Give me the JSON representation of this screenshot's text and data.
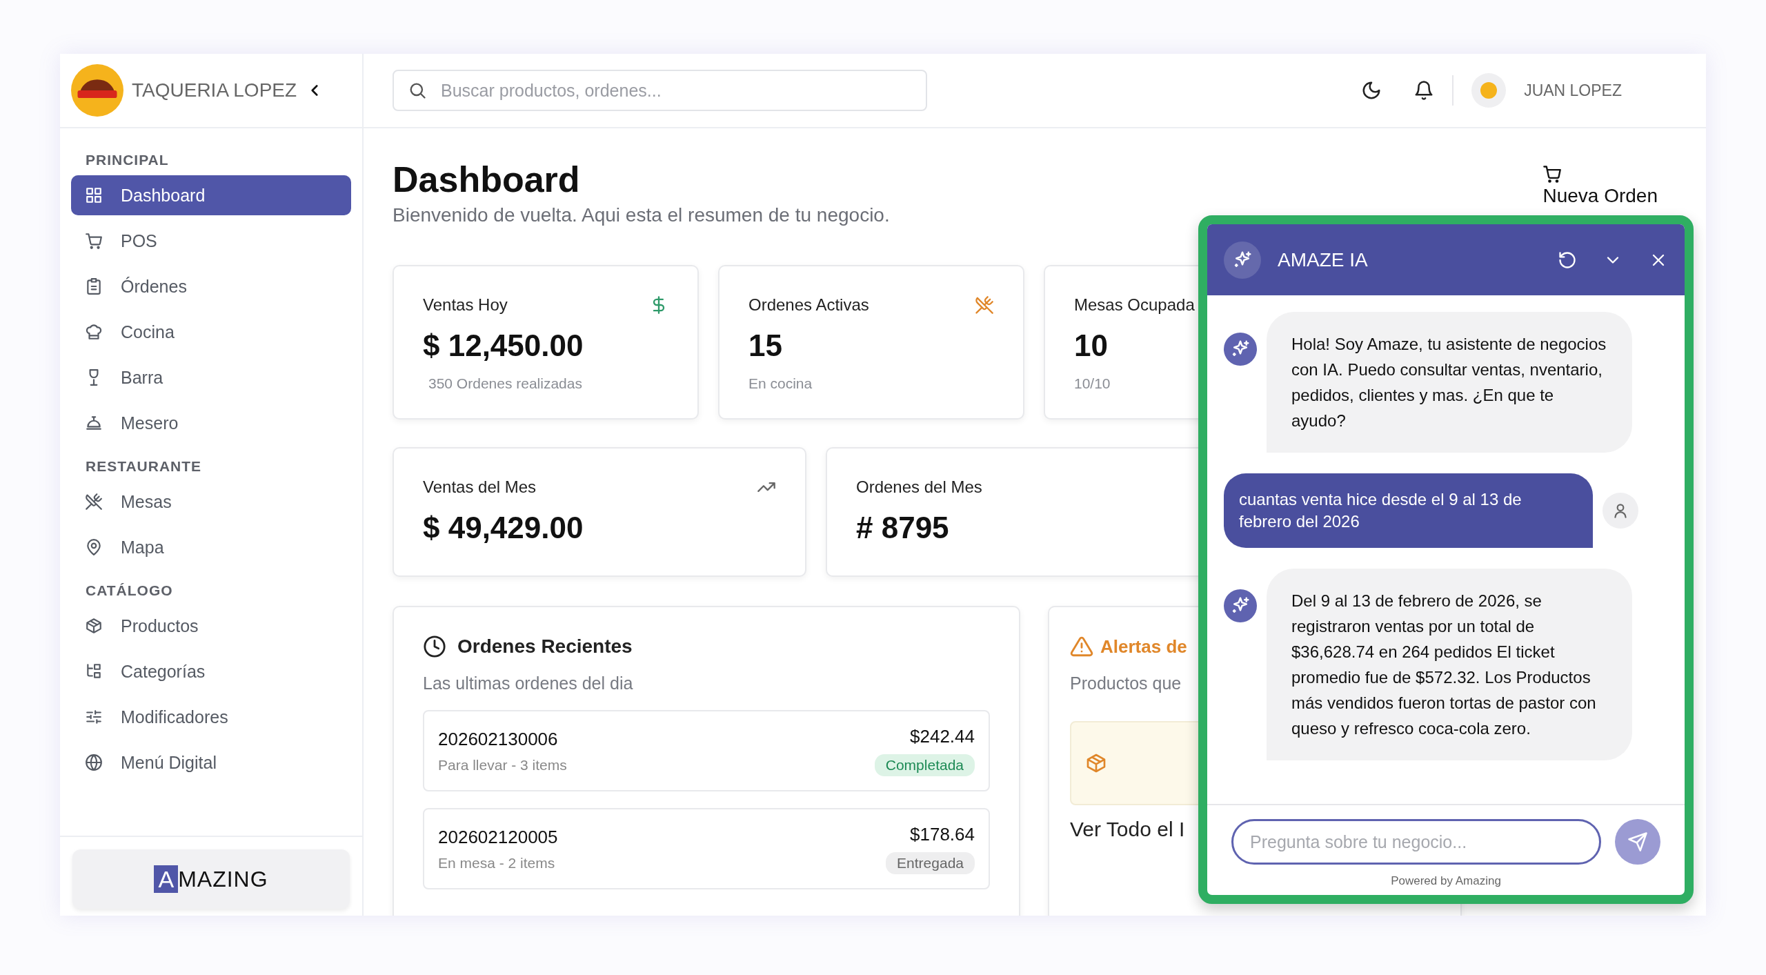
{
  "brand": {
    "name": "TAQUERIA LOPEZ"
  },
  "sidebar": {
    "sections": [
      {
        "heading": "PRINCIPAL",
        "items": [
          {
            "label": "Dashboard",
            "selected": true
          },
          {
            "label": "POS",
            "selected": false
          },
          {
            "label": "Órdenes",
            "selected": false
          },
          {
            "label": "Cocina",
            "selected": false
          },
          {
            "label": "Barra",
            "selected": false
          },
          {
            "label": "Mesero",
            "selected": false
          }
        ]
      },
      {
        "heading": "RESTAURANTE",
        "items": [
          {
            "label": "Mesas",
            "selected": false
          },
          {
            "label": "Mapa",
            "selected": false
          }
        ]
      },
      {
        "heading": "CATÁLOGO",
        "items": [
          {
            "label": "Productos",
            "selected": false
          },
          {
            "label": "Categorías",
            "selected": false
          },
          {
            "label": "Modificadores",
            "selected": false
          },
          {
            "label": "Menú Digital",
            "selected": false
          }
        ]
      }
    ],
    "footer_logo": {
      "mark": "A",
      "text": "MAZING"
    }
  },
  "search": {
    "placeholder": "Buscar productos, ordenes..."
  },
  "user": {
    "name": "JUAN LOPEZ"
  },
  "page": {
    "title": "Dashboard",
    "subtitle": "Bienvenido de vuelta. Aqui esta el resumen de tu negocio.",
    "new_order_button": "Nueva Orden"
  },
  "stats": [
    {
      "label": "Ventas Hoy",
      "value": "$ 12,450.00",
      "note": "350 Ordenes realizadas"
    },
    {
      "label": "Ordenes Activas",
      "value": "15",
      "note": "En cocina"
    },
    {
      "label": "Mesas Ocupada",
      "value": "10",
      "note": "10/10"
    }
  ],
  "month_stats": [
    {
      "label": "Ventas del Mes",
      "value": "$ 49,429.00"
    },
    {
      "label": "Ordenes del Mes",
      "value": "# 8795"
    }
  ],
  "recent_orders": {
    "title": "Ordenes Recientes",
    "subtitle": "Las ultimas ordenes del dia",
    "orders": [
      {
        "id": "202602130006",
        "detail": "Para llevar - 3 items",
        "total": "$242.44",
        "status": "Completada",
        "kind": "completed"
      },
      {
        "id": "202602120005",
        "detail": "En mesa - 2 items",
        "total": "$178.64",
        "status": "Entregada",
        "kind": "delivered"
      }
    ]
  },
  "alerts": {
    "title": "Alertas de",
    "subtitle": "Productos que",
    "link": "Ver Todo el I"
  },
  "chat": {
    "title": "AMAZE IA",
    "messages": [
      {
        "kind": "assistant",
        "text": "Hola! Soy Amaze, tu asistente de negocios con IA. Puedo consultar ventas, nventario, pedidos, clientes y mas. ¿En que te ayudo?"
      },
      {
        "kind": "user",
        "text": "cuantas venta hice desde el 9 al 13 de febrero del 2026"
      },
      {
        "kind": "assistant",
        "text": "Del 9 al 13 de febrero de 2026, se registraron ventas por un total de $36,628.74 en 264 pedidos El ticket promedio fue de $572.32. Los Productos más vendidos fueron tortas de pastor con queso y refresco coca-cola zero."
      }
    ],
    "input": {
      "placeholder": "Pregunta sobre tu negocio..."
    },
    "footer": "Powered by Amazing"
  }
}
